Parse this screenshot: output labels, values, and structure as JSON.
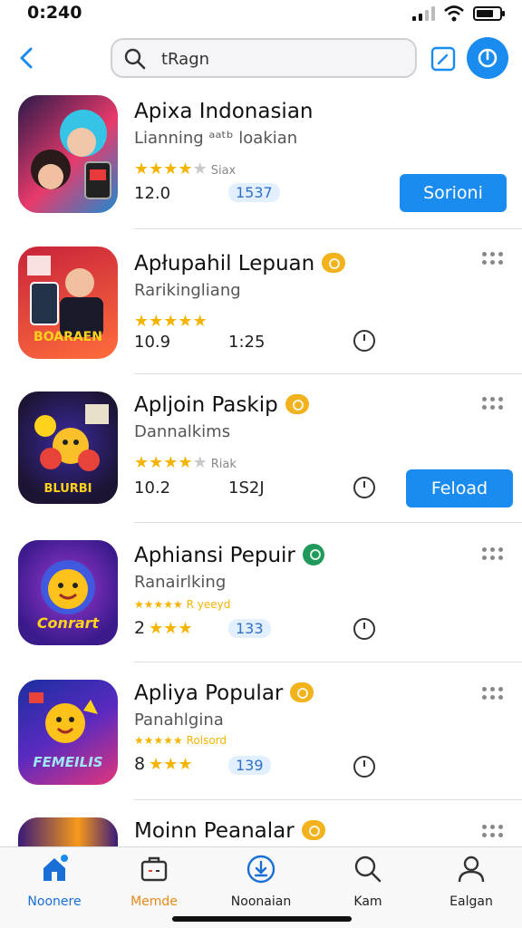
{
  "status": {
    "time": "0:240",
    "battery_level": 0.75
  },
  "search": {
    "value": "tRagn",
    "placeholder": "tRagn"
  },
  "apps": [
    {
      "title": "Apixa Indonasian",
      "subtitle": "Lianning ᵃᵃᵗᵇ loakian",
      "rating": 3.5,
      "rating_label": "Siax",
      "num": "12.0",
      "num2": "1537",
      "action": "Sorioni",
      "colors": [
        "#1b1b3a",
        "#e83a6b"
      ]
    },
    {
      "title": "Apłupahil Lepuan",
      "subtitle": "Rarikingliang",
      "rating": 4.5,
      "num": "10.9",
      "num2": "1:25",
      "badge": "orange",
      "colors": [
        "#c8233b",
        "#ff6d3b"
      ],
      "icon_text": "BOARAEN"
    },
    {
      "title": "Apljoin Paskip",
      "subtitle": "Dannalkims",
      "rating": 3.5,
      "rating_label": "Riak",
      "num": "10.2",
      "num2": "1S2J",
      "badge": "orange",
      "action": "Feload",
      "colors": [
        "#1d1433",
        "#3a2aa0"
      ],
      "icon_text": "BLURBI"
    },
    {
      "title": "Aphiansi Pepuir",
      "subtitle": "Ranairlking",
      "small_stars": "★★★★★ R yeeyd",
      "rating_prefix": "2",
      "rating": 3.5,
      "num2": "133",
      "badge": "green",
      "colors": [
        "#3b1a8c",
        "#9b3ad0"
      ],
      "icon_text": "Conrart"
    },
    {
      "title": "Apliya Popular",
      "subtitle": "Panahlgina",
      "small_stars": "★★★★★ Rolsord",
      "rating_prefix": "8",
      "rating": 3.5,
      "num2": "139",
      "badge": "orange",
      "colors": [
        "#1a2fa0",
        "#e2357a"
      ],
      "icon_text": "FEMEILIS"
    },
    {
      "title": "Moinn Peanalar",
      "badge": "orange",
      "colors": [
        "#3a1a7a",
        "#f79a1a"
      ]
    }
  ],
  "tabs": [
    {
      "label": "Noonere",
      "icon": "home-icon"
    },
    {
      "label": "Memde",
      "icon": "briefcase-icon"
    },
    {
      "label": "Noonaian",
      "icon": "download-icon"
    },
    {
      "label": "Kam",
      "icon": "search-icon"
    },
    {
      "label": "Ealgan",
      "icon": "person-icon"
    }
  ],
  "colors": {
    "accent": "#1a8cf0",
    "star": "#f5b400",
    "tab_active": "#1a6fd6",
    "tab_orange": "#e8891c"
  }
}
